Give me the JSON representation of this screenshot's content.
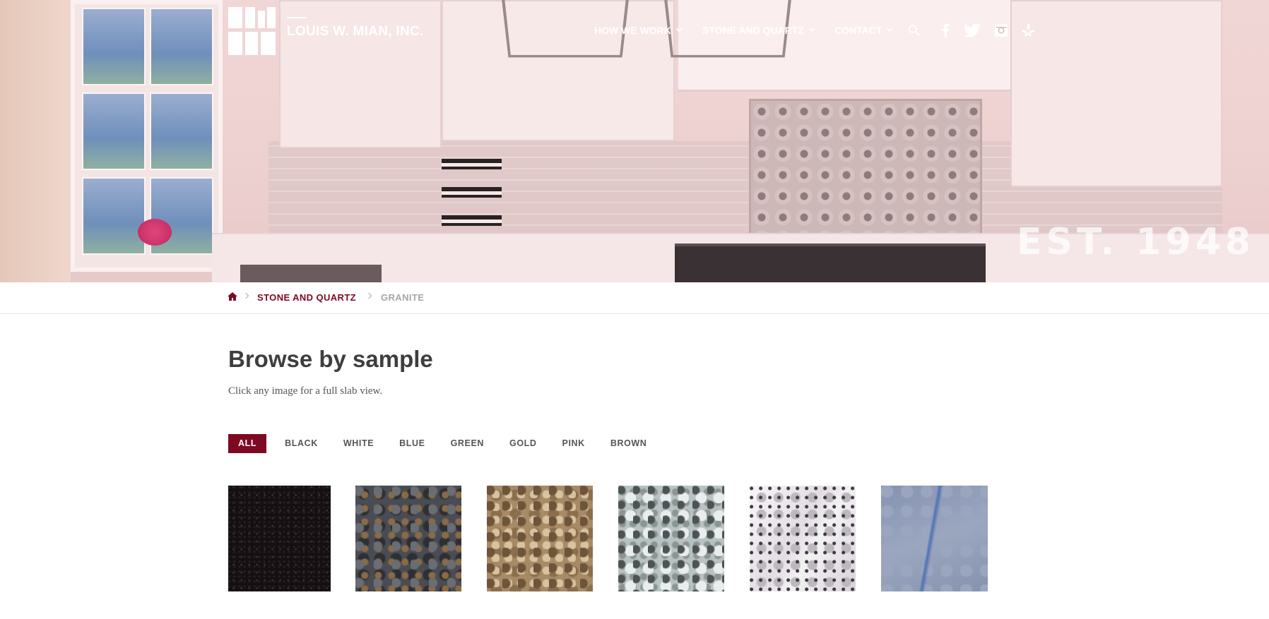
{
  "brand": {
    "name": "LOUIS W. MIAN, INC.",
    "logo": "mian-logo"
  },
  "hero": {
    "tagline": "EST. 1948"
  },
  "nav": {
    "items": [
      {
        "label": "HOW WE WORK",
        "has_dropdown": true
      },
      {
        "label": "STONE AND QUARTZ",
        "has_dropdown": true
      },
      {
        "label": "CONTACT",
        "has_dropdown": true
      }
    ],
    "icons": [
      "search-icon",
      "facebook-icon",
      "twitter-icon",
      "instagram-icon",
      "yelp-icon"
    ]
  },
  "breadcrumb": {
    "home_icon": "home-icon",
    "link": "STONE AND QUARTZ",
    "current": "GRANITE"
  },
  "main": {
    "title": "Browse by sample",
    "subtitle": "Click any image for a full slab view."
  },
  "filters": {
    "active": "ALL",
    "items": [
      "ALL",
      "BLACK",
      "WHITE",
      "BLUE",
      "GREEN",
      "GOLD",
      "PINK",
      "BROWN"
    ]
  },
  "samples": [
    {
      "color": "#141012"
    },
    {
      "color": "#494c53"
    },
    {
      "color": "#a78a66"
    },
    {
      "color": "#b9c2c3"
    },
    {
      "color": "#eeeaee"
    },
    {
      "color": "#8f9ab5"
    }
  ],
  "colors": {
    "accent": "#7d0a22",
    "title": "#3e3e3e",
    "muted": "#a6a6a6"
  }
}
